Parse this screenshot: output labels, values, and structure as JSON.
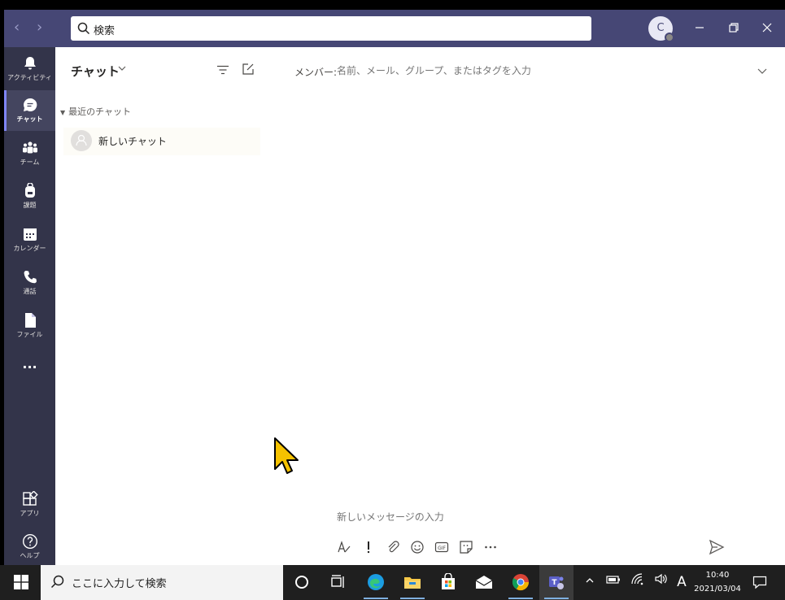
{
  "titlebar": {
    "search_placeholder": "検索",
    "avatar_initial": "C"
  },
  "rail": {
    "items": [
      {
        "label": "アクティビティ",
        "icon": "bell-icon"
      },
      {
        "label": "チャット",
        "icon": "chat-icon"
      },
      {
        "label": "チーム",
        "icon": "teams-icon"
      },
      {
        "label": "課題",
        "icon": "backpack-icon"
      },
      {
        "label": "カレンダー",
        "icon": "calendar-icon"
      },
      {
        "label": "通話",
        "icon": "phone-icon"
      },
      {
        "label": "ファイル",
        "icon": "file-icon"
      }
    ],
    "more": "···",
    "apps_label": "アプリ",
    "help_label": "ヘルプ"
  },
  "chat_list": {
    "title": "チャット",
    "recent_header": "最近のチャット",
    "items": [
      {
        "name": "新しいチャット"
      }
    ]
  },
  "main": {
    "to_label": "メンバー:",
    "to_placeholder": "名前、メール、グループ、またはタグを入力",
    "compose_placeholder": "新しいメッセージの入力"
  },
  "taskbar": {
    "search_placeholder": "ここに入力して検索",
    "ime": "A",
    "time": "10:40",
    "date": "2021/03/04"
  },
  "colors": {
    "titlebar": "#464775",
    "rail": "#33344a",
    "accent": "#7f85f5",
    "taskbar": "#1f1f1f"
  }
}
